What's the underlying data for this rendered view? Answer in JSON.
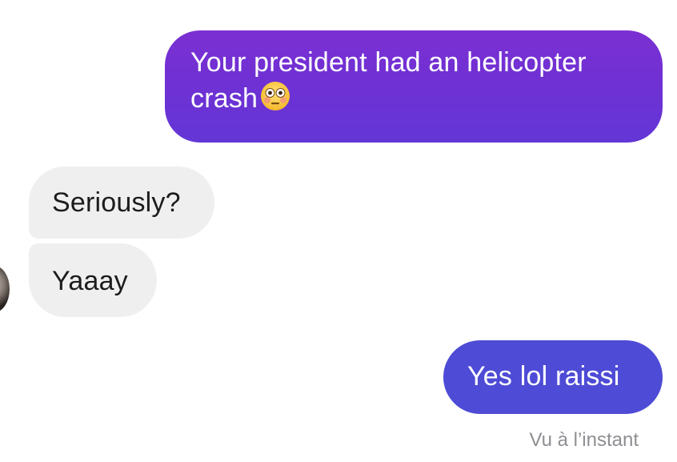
{
  "messages": {
    "sent_1": {
      "text": "Your president had an helicopter crash",
      "emoji": "flushed-face-emoji"
    },
    "received_1": {
      "text": "Seriously?"
    },
    "received_2": {
      "text": "Yaaay"
    },
    "sent_2": {
      "text": "Yes lol raissi"
    }
  },
  "status": {
    "seen": "Vu à l’instant"
  },
  "colors": {
    "sent_gradient_top": "#7b2fd2",
    "sent_gradient_bottom": "#6336d6",
    "sent_blue": "#4e4bd6",
    "received_bg": "#efefef",
    "status_text": "#8e8e93"
  }
}
